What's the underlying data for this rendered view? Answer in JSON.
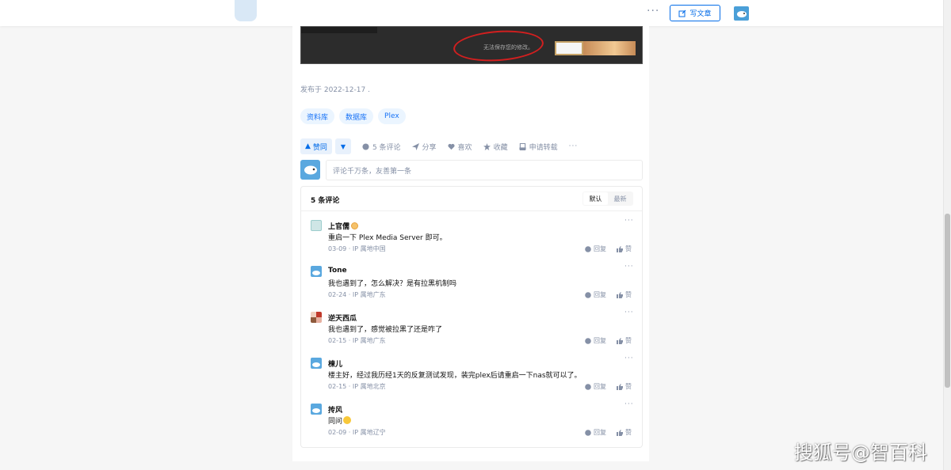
{
  "header": {
    "write_label": "写文章",
    "more_label": "···"
  },
  "article": {
    "image_caption": "无法保存您的修改。",
    "publish_info": "发布于 2022-12-17 .",
    "tags": [
      "资料库",
      "数据库",
      "Plex"
    ],
    "actions": {
      "upvote_label": "赞同",
      "downvote_label": "▼",
      "comments_label": "5 条评论",
      "share_label": "分享",
      "like_label": "喜欢",
      "collect_label": "收藏",
      "reprint_label": "申请转载",
      "more_label": "···"
    }
  },
  "comment_editor": {
    "placeholder": "评论千万条，友善第一条"
  },
  "comments_section": {
    "title": "5 条评论",
    "sort_default": "默认",
    "sort_latest": "最新",
    "reply_label": "回复",
    "like_label": "赞",
    "more_label": "···",
    "items": [
      {
        "name": "上官儒",
        "text": "重启一下 Plex Media Server 即可。",
        "meta": "03-09 · IP 属地中国",
        "avatar_icon": "pattern-avatar-icon"
      },
      {
        "name": "Tone",
        "text": "我也遇到了，怎么解决？是有拉黑机制吗",
        "meta": "02-24 · IP 属地广东",
        "avatar_icon": "bird-avatar-icon"
      },
      {
        "name": "逆天西瓜",
        "text": "我也遇到了，感觉被拉黑了还是咋了",
        "meta": "02-15 · IP 属地广东",
        "avatar_icon": "photo-avatar-icon"
      },
      {
        "name": "楝儿",
        "text": "楼主好，经过我历经1天的反复测试发现，装完plex后请重启一下nas就可以了。",
        "meta": "02-15 · IP 属地北京",
        "avatar_icon": "bird-avatar-icon"
      },
      {
        "name": "抟风",
        "text": "同问",
        "meta": "02-09 · IP 属地辽宁",
        "avatar_icon": "bird-avatar-icon"
      }
    ]
  },
  "watermark": "搜狐号@智百科",
  "colors": {
    "accent": "#056de8",
    "tag_bg": "#ebf5ff",
    "muted": "#8590a6"
  }
}
